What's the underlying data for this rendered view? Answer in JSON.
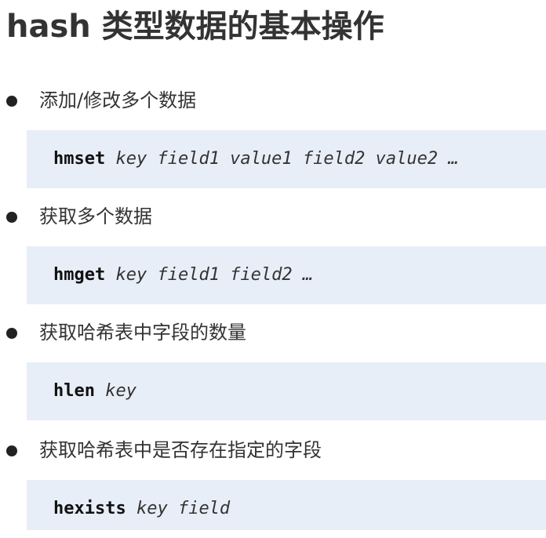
{
  "title": "hash 类型数据的基本操作",
  "items": [
    {
      "bullet": "添加/修改多个数据",
      "command": "hmset",
      "args": "key field1 value1 field2 value2 …"
    },
    {
      "bullet": "获取多个数据",
      "command": "hmget",
      "args": "key field1 field2 …"
    },
    {
      "bullet": "获取哈希表中字段的数量",
      "command": "hlen",
      "args": "key"
    },
    {
      "bullet": "获取哈希表中是否存在指定的字段",
      "command": "hexists",
      "args": "key field"
    }
  ]
}
